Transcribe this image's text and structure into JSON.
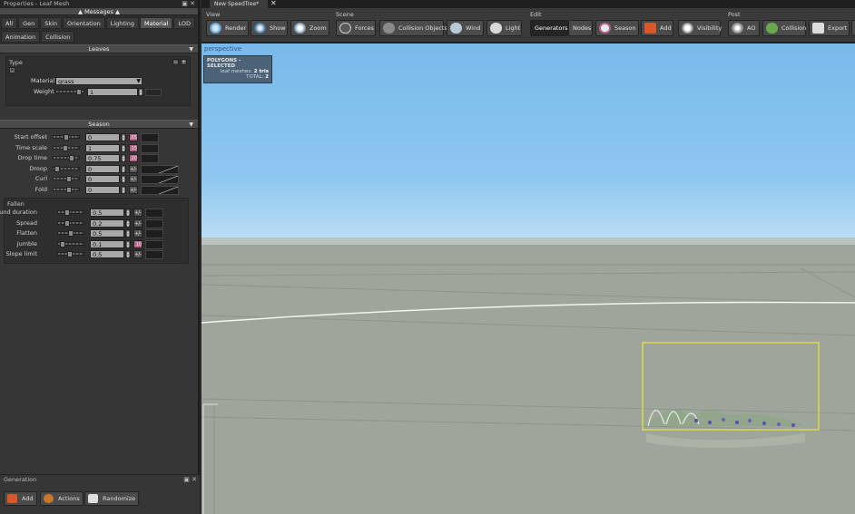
{
  "panel": {
    "title": "Properties - Leaf Mesh",
    "messages": "Messages",
    "tabs": [
      "All",
      "Gen",
      "Skin",
      "Orientation",
      "Lighting",
      "Material",
      "LOD",
      "Animation",
      "Collision"
    ],
    "active_tab": "Material",
    "leaves": {
      "header": "Leaves",
      "type_label": "Type",
      "material_label": "Material",
      "material_value": "grass",
      "weight_label": "Weight",
      "weight_value": "1"
    },
    "season": {
      "header": "Season",
      "rows": [
        {
          "label": "Start offset",
          "value": "0",
          "pm": ".65",
          "pink": true,
          "knob": 0.45
        },
        {
          "label": "Time scale",
          "value": "1",
          "pm": ".15",
          "pink": true,
          "knob": 0.4
        },
        {
          "label": "Drop time",
          "value": "0.75",
          "pm": ".20",
          "pink": true,
          "knob": 0.7
        },
        {
          "label": "Droop",
          "value": "0",
          "pm": "+/-",
          "pink": false,
          "knob": 0.05
        },
        {
          "label": "Curl",
          "value": "0",
          "pm": "+/-",
          "pink": false,
          "knob": 0.6
        },
        {
          "label": "Fold",
          "value": "0",
          "pm": "+/-",
          "pink": false,
          "knob": 0.6
        }
      ],
      "fallen": {
        "label": "Fallen",
        "rows": [
          {
            "label": "Ground duration",
            "value": "0.5",
            "pm": "+/-",
            "pink": false,
            "knob": 0.3
          },
          {
            "label": "Spread",
            "value": "0.2",
            "pm": "+/-",
            "pink": false,
            "knob": 0.3
          },
          {
            "label": "Flatten",
            "value": "0.5",
            "pm": "+/-",
            "pink": false,
            "knob": 0.45
          },
          {
            "label": "Jumble",
            "value": "0.1",
            "pm": ".10",
            "pink": true,
            "knob": 0.1
          },
          {
            "label": "Slope limit",
            "value": "0.5",
            "pm": "+/-",
            "pink": false,
            "knob": 0.4
          }
        ]
      }
    },
    "generation": {
      "title": "Generation",
      "add": "Add",
      "actions": "Actions",
      "randomize": "Randomize"
    }
  },
  "document": {
    "tab": "New SpeedTree*"
  },
  "toolbar": {
    "view": {
      "label": "View",
      "render": "Render",
      "show": "Show",
      "zoom": "Zoom"
    },
    "scene": {
      "label": "Scene",
      "forces": "Forces",
      "collision_objects": "Collision Objects",
      "wind": "Wind",
      "light": "Light"
    },
    "edit": {
      "label": "Edit",
      "generators": "Generators",
      "nodes": "Nodes",
      "season": "Season",
      "add": "Add",
      "visibility": "Visibility"
    },
    "post": {
      "label": "Post",
      "ao": "AO",
      "collision": "Collision",
      "export": "Export"
    }
  },
  "viewport": {
    "label": "perspective",
    "overlay": {
      "title": "POLYGONS - SELECTED",
      "leaf_meshes_label": "leaf meshes:",
      "leaf_meshes_value": "2 tris",
      "total_label": "TOTAL:",
      "total_value": "2"
    }
  },
  "colors": {
    "accent_pink": "#b9628a",
    "selection": "#e6e23a",
    "sky": "#79b9ea",
    "ground": "#9ea59b"
  }
}
